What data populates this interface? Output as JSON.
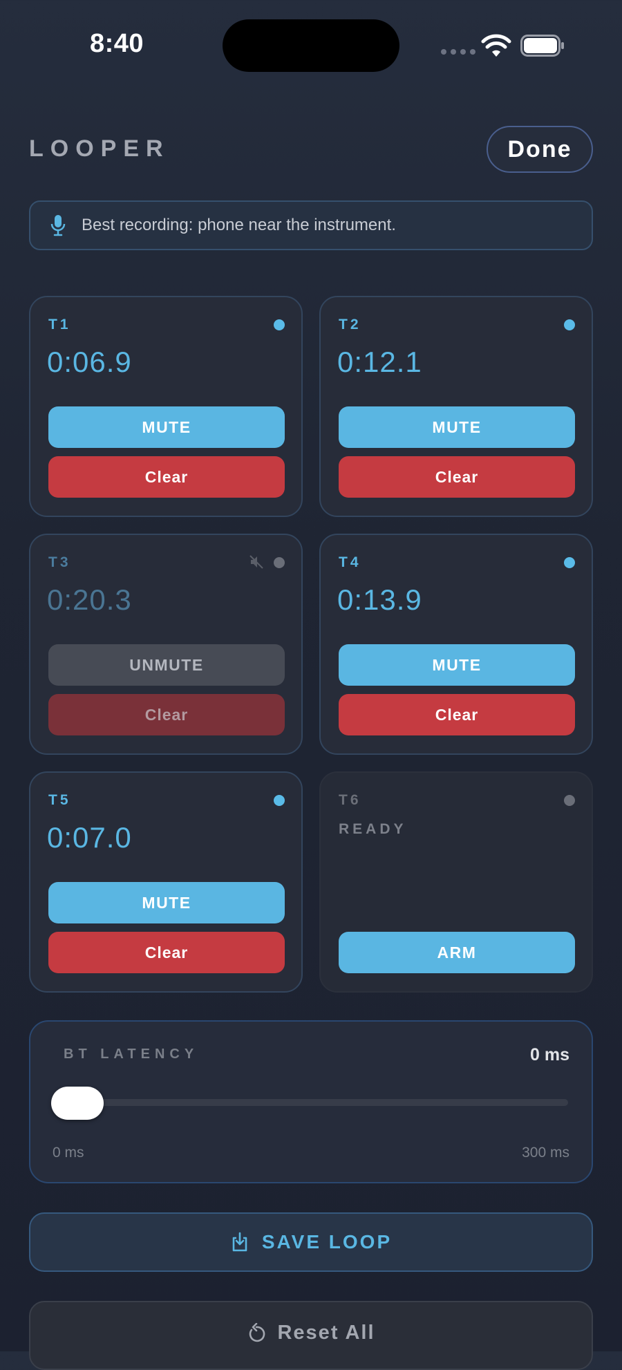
{
  "status_bar": {
    "time": "8:40"
  },
  "header": {
    "title": "LOOPER",
    "done_label": "Done"
  },
  "tip": {
    "text": "Best recording: phone near the instrument."
  },
  "tracks": [
    {
      "name": "T1",
      "time": "0:06.9",
      "mute_label": "MUTE",
      "clear_label": "Clear"
    },
    {
      "name": "T2",
      "time": "0:12.1",
      "mute_label": "MUTE",
      "clear_label": "Clear"
    },
    {
      "name": "T3",
      "time": "0:20.3",
      "mute_label": "UNMUTE",
      "clear_label": "Clear",
      "muted": true
    },
    {
      "name": "T4",
      "time": "0:13.9",
      "mute_label": "MUTE",
      "clear_label": "Clear"
    },
    {
      "name": "T5",
      "time": "0:07.0",
      "mute_label": "MUTE",
      "clear_label": "Clear"
    },
    {
      "name": "T6",
      "status": "READY",
      "arm_label": "ARM"
    }
  ],
  "latency": {
    "label": "BT LATENCY",
    "value": "0 ms",
    "min_label": "0 ms",
    "max_label": "300 ms",
    "level": 0
  },
  "actions": {
    "save_label": "SAVE LOOP",
    "reset_label": "Reset All"
  },
  "colors": {
    "accent": "#5ab6e2",
    "danger": "#c53b41",
    "background": "#1f2533"
  }
}
